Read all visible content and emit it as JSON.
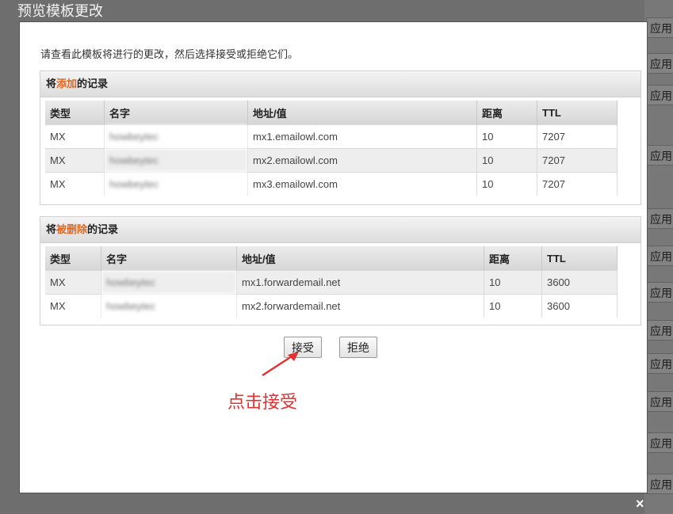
{
  "dialog": {
    "title": "预览模板更改",
    "intro": "请查看此模板将进行的更改，然后选择接受或拒绝它们。",
    "accept_label": "接受",
    "reject_label": "拒绝",
    "close_glyph": "×"
  },
  "added": {
    "prefix": "将",
    "highlight": "添加",
    "suffix": "的记录",
    "headers": [
      "类型",
      "名字",
      "地址/值",
      "距离",
      "TTL"
    ],
    "rows": [
      [
        "MX",
        "howbeytec",
        "mx1.emailowl.com",
        "10",
        "7207"
      ],
      [
        "MX",
        "howbeytec",
        "mx2.emailowl.com",
        "10",
        "7207"
      ],
      [
        "MX",
        "howbeytec",
        "mx3.emailowl.com",
        "10",
        "7207"
      ]
    ]
  },
  "deleted": {
    "prefix": "将",
    "highlight": "被删除",
    "suffix": "的记录",
    "headers": [
      "类型",
      "名字",
      "地址/值",
      "距离",
      "TTL"
    ],
    "rows": [
      [
        "MX",
        "howbeytec",
        "mx1.forwardemail.net",
        "10",
        "3600"
      ],
      [
        "MX",
        "howbeytec",
        "mx2.forwardemail.net",
        "10",
        "3600"
      ]
    ]
  },
  "background": {
    "apply_label": "应用"
  },
  "annotation": {
    "text": "点击接受",
    "color": "#e53030"
  },
  "colors": {
    "highlight": "#e8651a"
  }
}
